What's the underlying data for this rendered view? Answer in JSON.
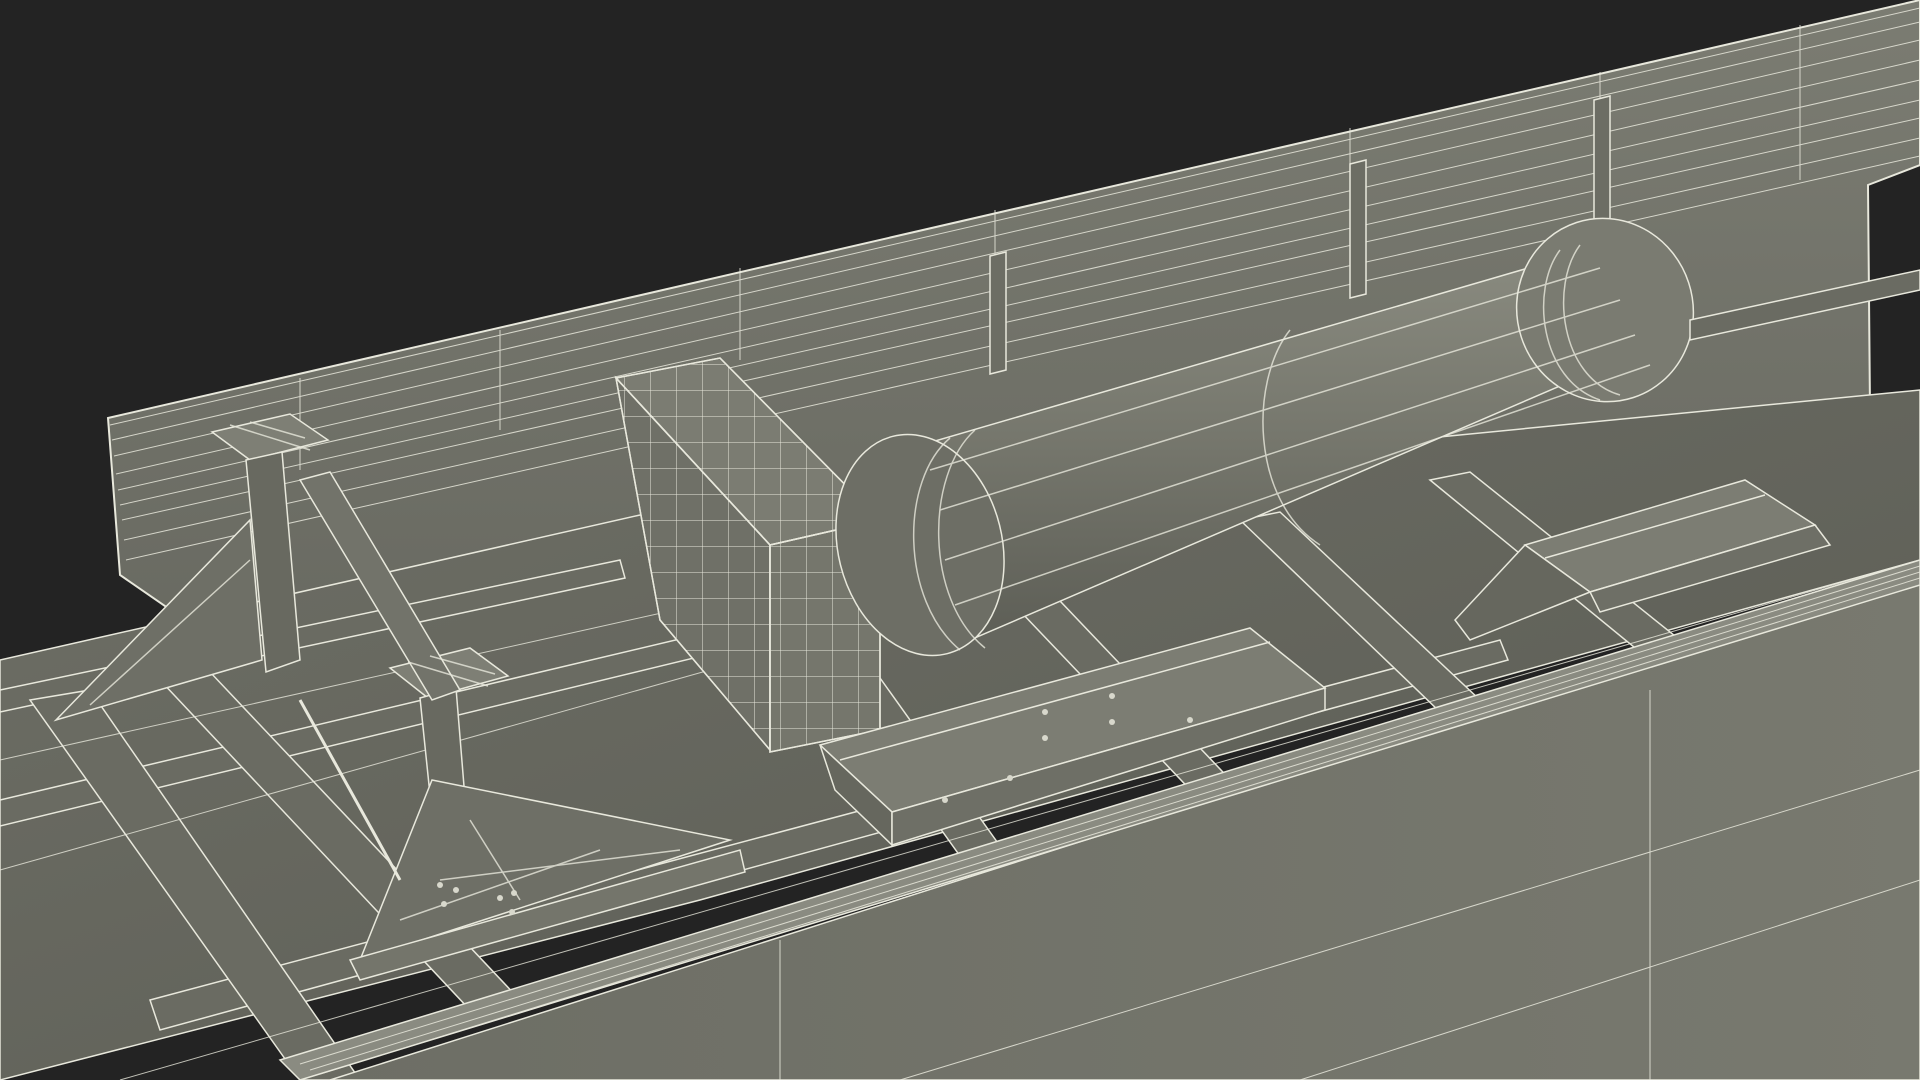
{
  "render": {
    "style": "wireframe-shaded",
    "colors": {
      "background": "#232323",
      "surface": "#74756b",
      "surface_dark": "#5f6058",
      "surface_light": "#8a8b81",
      "wire": "#e8e8dc"
    },
    "objects": [
      "back-wall-panel",
      "deck-floor",
      "left-crane-base",
      "crate-box",
      "cylinder-tank",
      "center-rail-bracket",
      "right-rail-bracket",
      "front-wall-panel"
    ]
  }
}
